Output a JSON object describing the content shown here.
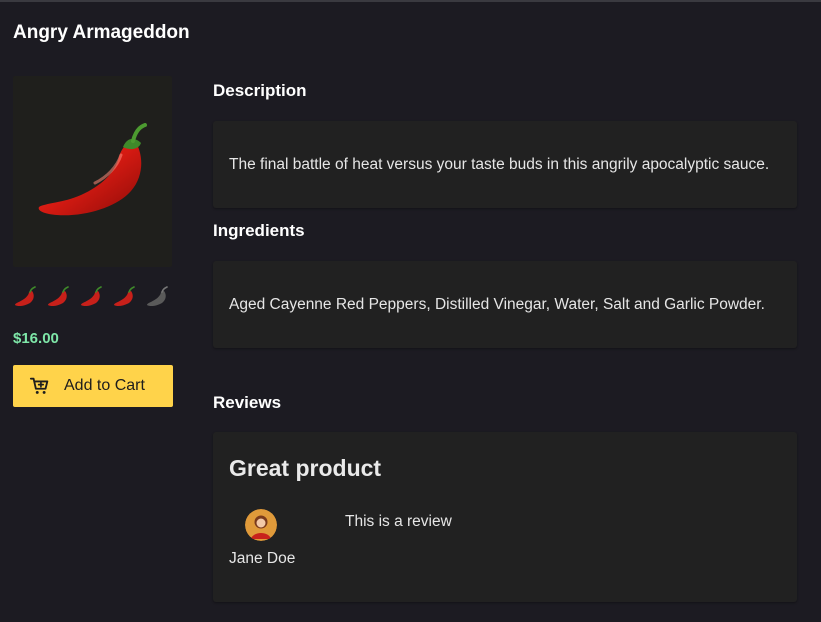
{
  "product": {
    "title": "Angry Armageddon",
    "image_icon": "chili-pepper-icon",
    "rating": {
      "value": 4,
      "max": 5
    },
    "price": "$16.00",
    "add_to_cart_label": "Add to Cart"
  },
  "sections": {
    "description_heading": "Description",
    "description_text": "The final battle of heat versus your taste buds in this angrily apocalyptic sauce.",
    "ingredients_heading": "Ingredients",
    "ingredients_text": "Aged Cayenne Red Peppers, Distilled Vinegar, Water, Salt and Garlic Powder.",
    "reviews_heading": "Reviews"
  },
  "reviews": [
    {
      "title": "Great product",
      "author": "Jane Doe",
      "body": "This is a review"
    }
  ],
  "colors": {
    "background": "#1c1b22",
    "panel": "#212121",
    "price": "#7ee6a8",
    "button": "#ffd34a",
    "pepper_active": "#c7201a",
    "pepper_inactive": "#5a5a5a"
  }
}
